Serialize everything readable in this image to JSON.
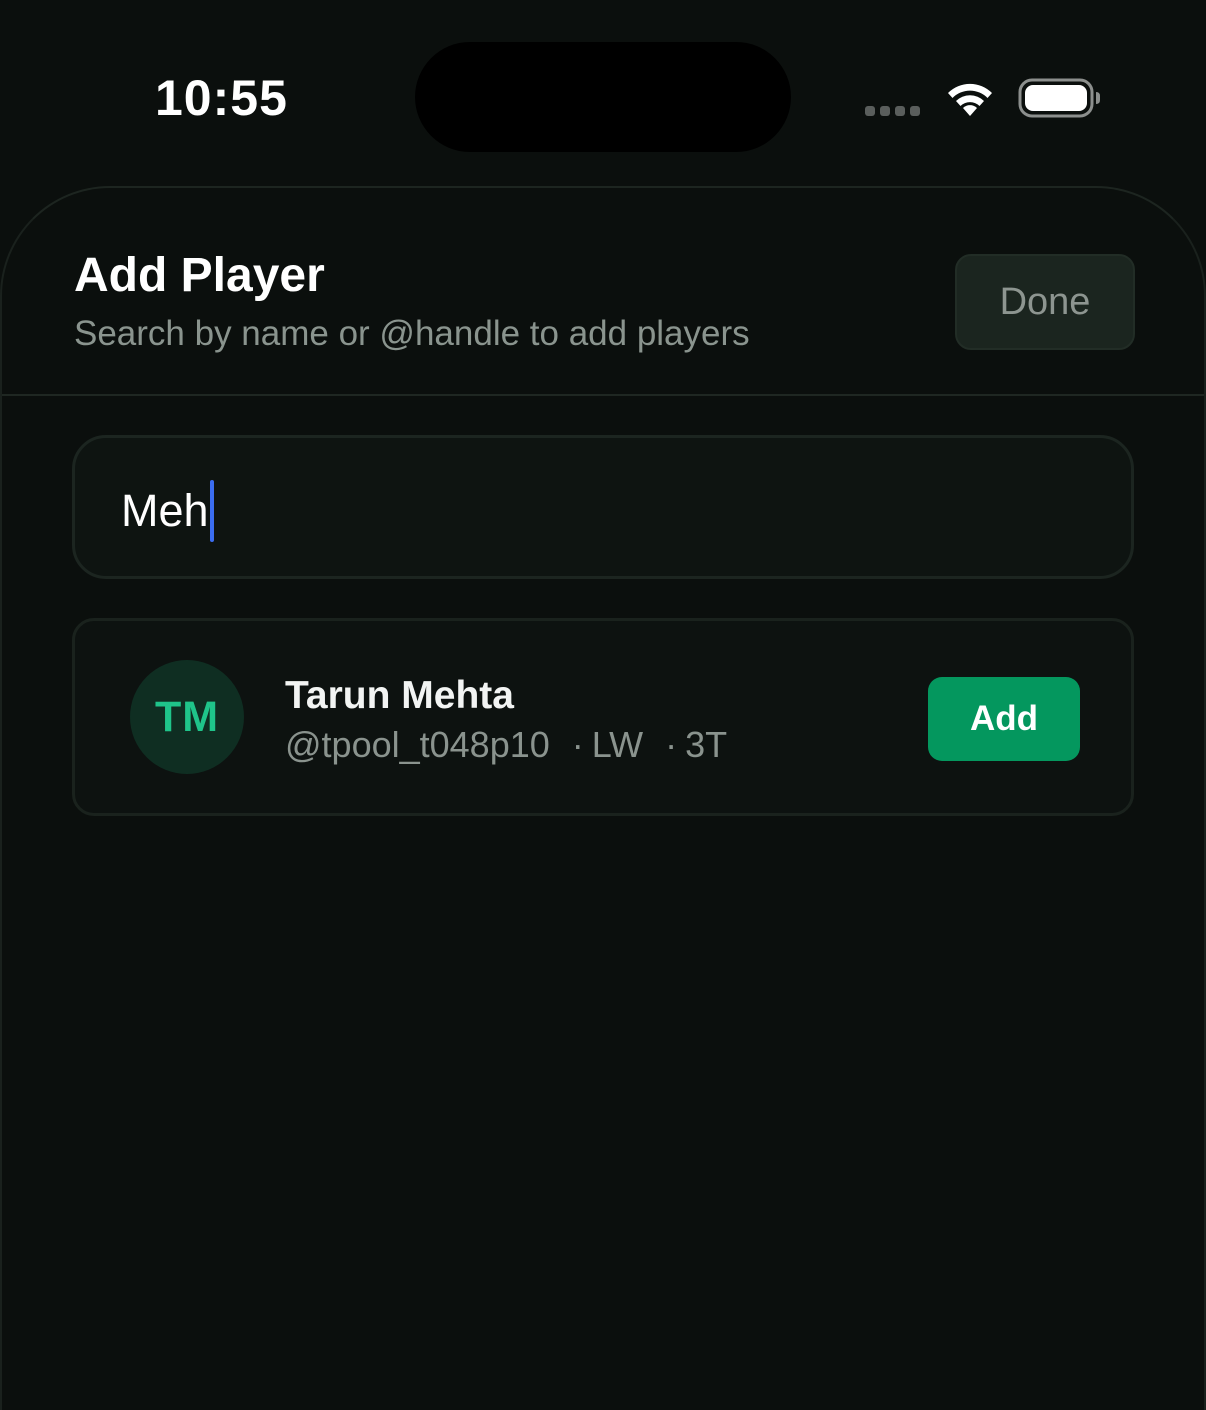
{
  "status_bar": {
    "time": "10:55"
  },
  "sheet": {
    "title": "Add Player",
    "subtitle": "Search by name or @handle to add players",
    "done_label": "Done"
  },
  "search": {
    "value": "Meh"
  },
  "results": [
    {
      "initials": "TM",
      "name": "Tarun Mehta",
      "handle": "@tpool_t048p10",
      "position": "LW",
      "tier": "3T",
      "add_label": "Add"
    }
  ],
  "colors": {
    "accent": "#04975e",
    "avatar_text": "#1fc48a",
    "caret": "#3b6df0",
    "background": "#0b0f0d"
  }
}
